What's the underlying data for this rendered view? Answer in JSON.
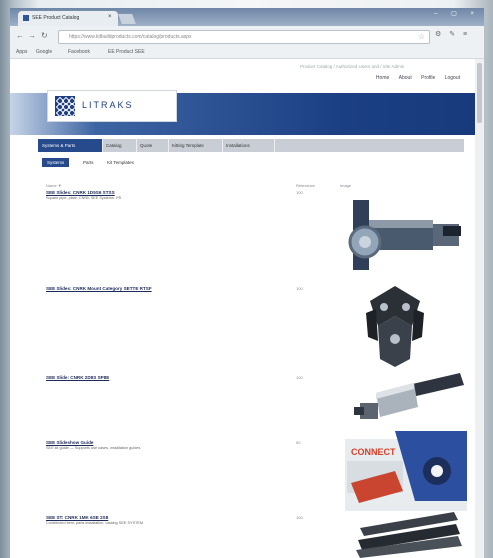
{
  "browser": {
    "tab_title": "SEE Product Catalog",
    "url": "https://www.kitbuildproducts.com/catalog/products.aspx",
    "bookmarks": [
      "Apps",
      "Google",
      "Facebook",
      "EE Product SEE"
    ]
  },
  "site": {
    "logo_text": "LITRAKS",
    "tagline": "Product Catalog / Authorized Users and / Site Admin",
    "utility_nav": [
      "Home",
      "About",
      "Profile",
      "Logout"
    ],
    "main_nav": [
      {
        "label": "Systems & Parts",
        "active": true
      },
      {
        "label": "Catalog",
        "active": false
      },
      {
        "label": "Quote",
        "active": false
      },
      {
        "label": "Kitting Template",
        "active": false
      },
      {
        "label": "Installations",
        "active": false
      }
    ],
    "sub_nav": [
      {
        "label": "Systems",
        "active": true
      },
      {
        "label": "Parts",
        "active": false
      },
      {
        "label": "Kit Templates",
        "active": false
      }
    ],
    "columns": {
      "name": "Name ▼",
      "relevance": "Relevance",
      "image": "Image"
    }
  },
  "products": [
    {
      "title": "SEE Slides: CNRK 1D5S6 STSS",
      "desc": "Square pipe, plate, CNRK SEE Systems. PS",
      "relevance": "100",
      "image": "roller-shaft-icon"
    },
    {
      "title": "SEE Slides: CNRK Mount Category SETTE RTSF",
      "desc": "",
      "relevance": "100",
      "image": "corner-bracket-icon"
    },
    {
      "title": "SEE Slide: CNRK 2D8S SP8E",
      "desc": "",
      "relevance": "100",
      "image": "shaft-connector-icon"
    },
    {
      "title": "SEE Slideshow Guide",
      "desc": "SEE kit guide — Supports use cases, installation guides",
      "relevance": "50",
      "image": "connect-kit-icon"
    },
    {
      "title": "SEE ST: CNRK 1MK 6SE 2S8",
      "desc": "Contributed item, parts installation, catalog SEE SYSTEM",
      "relevance": "100",
      "image": "rail-profiles-icon"
    }
  ],
  "image_label": "CONNECT"
}
